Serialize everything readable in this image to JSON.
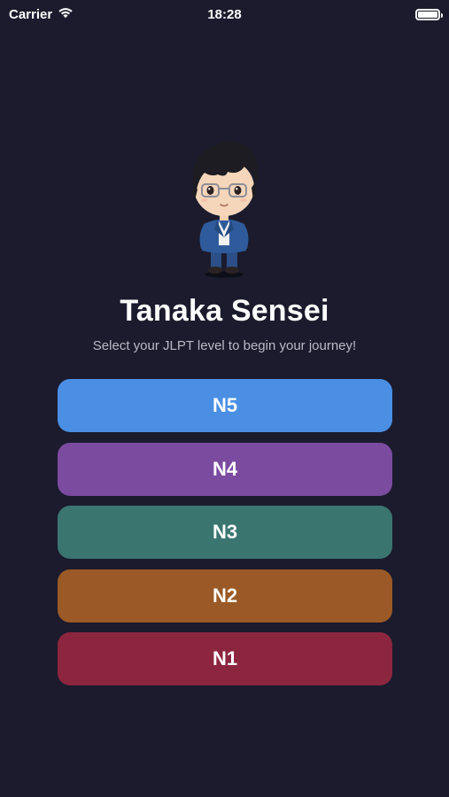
{
  "status_bar": {
    "carrier": "Carrier",
    "time": "18:28"
  },
  "header": {
    "title": "Tanaka Sensei",
    "subtitle": "Select your JLPT level to begin your journey!"
  },
  "levels": [
    {
      "label": "N5",
      "color": "#4a8fe4"
    },
    {
      "label": "N4",
      "color": "#7b4ba0"
    },
    {
      "label": "N3",
      "color": "#3b7570"
    },
    {
      "label": "N2",
      "color": "#9a5926"
    },
    {
      "label": "N1",
      "color": "#8c263e"
    }
  ],
  "icons": {
    "wifi": "wifi-icon",
    "battery": "battery-icon",
    "avatar": "tanaka-sensei-avatar"
  }
}
